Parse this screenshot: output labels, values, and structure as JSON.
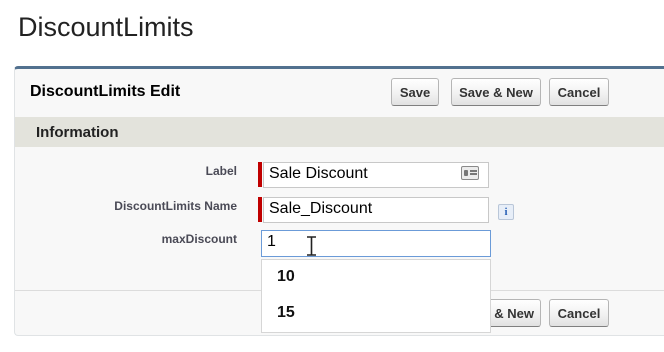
{
  "page": {
    "title": "DiscountLimits"
  },
  "edit": {
    "title": "DiscountLimits Edit",
    "buttons": {
      "save": "Save",
      "save_new": "Save & New",
      "cancel": "Cancel"
    }
  },
  "section": {
    "title": "Information"
  },
  "fields": {
    "label": {
      "label": "Label",
      "value": "Sale Discount",
      "required": true
    },
    "name": {
      "label": "DiscountLimits Name",
      "value": "Sale_Discount",
      "required": true,
      "info_icon": "i"
    },
    "max_discount": {
      "label": "maxDiscount",
      "value": "1",
      "required": false
    }
  },
  "dropdown": {
    "options": [
      "10",
      "15"
    ]
  },
  "bottom_buttons": {
    "save_new_partial": "& New",
    "cancel": "Cancel"
  },
  "colors": {
    "accent_border": "#52718f",
    "required_marker": "#c00000",
    "section_bar": "#e3e3dc"
  }
}
